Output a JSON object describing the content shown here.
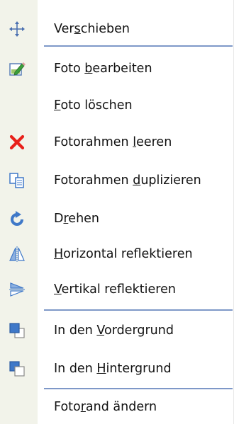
{
  "menu": {
    "items": [
      {
        "label": "Verschieben",
        "mnemonic": "s",
        "icon": "move-icon"
      },
      {
        "label": "Foto bearbeiten",
        "mnemonic": "b",
        "icon": "edit-photo-icon"
      },
      {
        "label": "Foto löschen",
        "mnemonic": "F",
        "icon": ""
      },
      {
        "label": "Fotorahmen leeren",
        "mnemonic": "l",
        "icon": "delete-x-icon"
      },
      {
        "label": "Fotorahmen duplizieren",
        "mnemonic": "d",
        "icon": "duplicate-icon"
      },
      {
        "label": "Drehen",
        "mnemonic": "r",
        "icon": "rotate-icon"
      },
      {
        "label": "Horizontal reflektieren",
        "mnemonic": "H",
        "icon": "flip-horizontal-icon"
      },
      {
        "label": "Vertikal reflektieren",
        "mnemonic": "V",
        "icon": "flip-vertical-icon"
      },
      {
        "label": "In den Vordergrund",
        "mnemonic": "V",
        "icon": "bring-to-front-icon"
      },
      {
        "label": "In den Hintergrund",
        "mnemonic": "H",
        "icon": "send-to-back-icon"
      },
      {
        "label": "Fotorand ändern",
        "mnemonic": "r",
        "icon": ""
      }
    ]
  },
  "colors": {
    "gutter": "#f2f3ea",
    "separator": "#7e98c8",
    "delete_red": "#e8201a",
    "icon_blue": "#3f78c8"
  }
}
